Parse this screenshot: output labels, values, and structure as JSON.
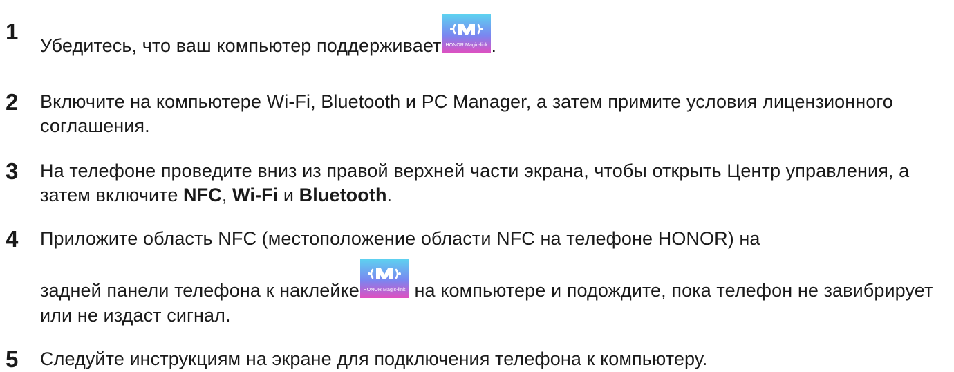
{
  "colors": {
    "badge_top": "#5dd3f0",
    "badge_mid": "#6c8cf2",
    "badge_bottom": "#e04fc0",
    "text": "#1a1a1a"
  },
  "badge": {
    "icon": "honor-magic-link-logo",
    "caption": "HONOR Magic-link"
  },
  "steps": [
    {
      "number": "1",
      "text_before": "Убедитесь, что ваш компьютер поддерживает",
      "text_after": "."
    },
    {
      "number": "2",
      "text": "Включите на компьютере Wi-Fi, Bluetooth и PC Manager, а затем примите условия лицензионного соглашения."
    },
    {
      "number": "3",
      "text_before": "На телефоне проведите вниз из правой верхней части экрана, чтобы открыть Центр управления, а затем включите ",
      "kw1": "NFC",
      "sep1": ", ",
      "kw2": "Wi-Fi",
      "sep2": " и ",
      "kw3": "Bluetooth",
      "text_after": "."
    },
    {
      "number": "4",
      "line1": "Приложите область NFC (местоположение области NFC на телефоне HONOR) на",
      "text_before": "задней панели телефона к наклейке",
      "text_after": " на компьютере и подождите, пока телефон не завибрирует или не издаст сигнал."
    },
    {
      "number": "5",
      "text": "Следуйте инструкциям на экране для подключения телефона к компьютеру."
    }
  ]
}
